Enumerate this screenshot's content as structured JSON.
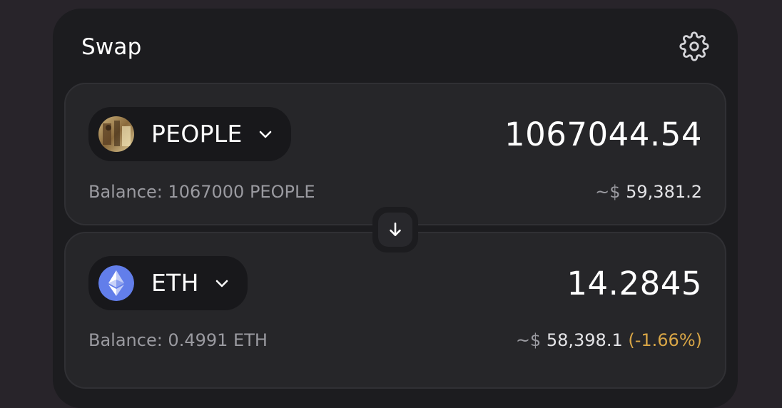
{
  "swap": {
    "title": "Swap",
    "settings_icon": "gear-icon"
  },
  "from": {
    "token_symbol": "PEOPLE",
    "token_logo_icon": "people-token-logo",
    "amount": "1067044.54",
    "balance_text": "Balance: 1067000 PEOPLE",
    "usd_prefix": "~$",
    "usd_value": "59,381.2"
  },
  "flip": {
    "icon": "arrow-down-icon"
  },
  "to": {
    "token_symbol": "ETH",
    "token_logo_icon": "eth-token-logo",
    "amount": "14.2845",
    "balance_text": "Balance: 0.4991 ETH",
    "usd_prefix": "~$",
    "usd_value": "58,398.1",
    "price_impact": "(-1.66%)"
  },
  "colors": {
    "page_bg": "#28242a",
    "card_bg": "#1c1c1f",
    "panel_bg": "#262629",
    "selector_bg": "#18181b",
    "muted_text": "#9a9aa0",
    "warning": "#d9a646",
    "eth_blue": "#627eea"
  }
}
